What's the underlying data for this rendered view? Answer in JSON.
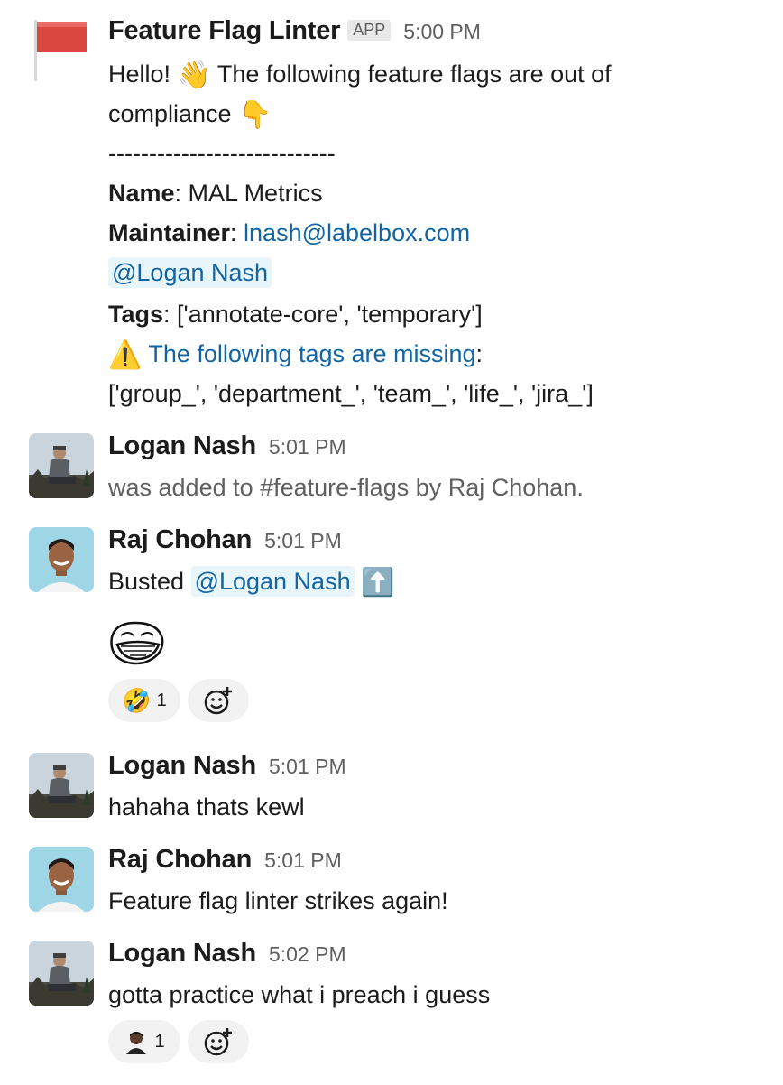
{
  "messages": {
    "m1": {
      "sender": "Feature Flag Linter",
      "badge": "APP",
      "time": "5:00 PM",
      "greeting": "Hello! ",
      "greeting_emoji": "👋",
      "greeting_rest": " The following feature flags are out of",
      "line2": "compliance ",
      "line2_emoji": "👇",
      "divider": "----------------------------",
      "name_label": "Name",
      "name_value": ": MAL Metrics",
      "maintainer_label": "Maintainer",
      "maintainer_sep": ": ",
      "maintainer_email": "lnash@labelbox.com",
      "mention": "@Logan Nash",
      "tags_label": "Tags",
      "tags_value": ": ['annotate-core', 'temporary']",
      "warning_emoji": "⚠️",
      "missing_link": "The following tags are missing",
      "missing_colon": ":",
      "missing_tags": " ['group_', 'department_', 'team_', 'life_', 'jira_']"
    },
    "m2": {
      "sender": "Logan Nash",
      "time": "5:01 PM",
      "text": "was added to #feature-flags by Raj Chohan."
    },
    "m3": {
      "sender": "Raj Chohan",
      "time": "5:01 PM",
      "text": "Busted ",
      "mention": "@Logan Nash",
      "emoji": "⬆️",
      "reaction_emoji": "🤣",
      "reaction_count": "1"
    },
    "m4": {
      "sender": "Logan Nash",
      "time": "5:01 PM",
      "text": "hahaha thats kewl"
    },
    "m5": {
      "sender": "Raj Chohan",
      "time": "5:01 PM",
      "text": "Feature flag linter strikes again!"
    },
    "m6": {
      "sender": "Logan Nash",
      "time": "5:02 PM",
      "text": "gotta practice what i preach i guess",
      "reaction_count": "1"
    }
  },
  "icons": {
    "flag": "red-flag-icon",
    "add_reaction": "add-reaction-icon",
    "troll": "trollface-icon"
  },
  "colors": {
    "link": "#1264a3",
    "mention_bg": "#e8f5fa",
    "flag_red": "#d9473f",
    "avatar_sky": "#9fd6e6"
  }
}
